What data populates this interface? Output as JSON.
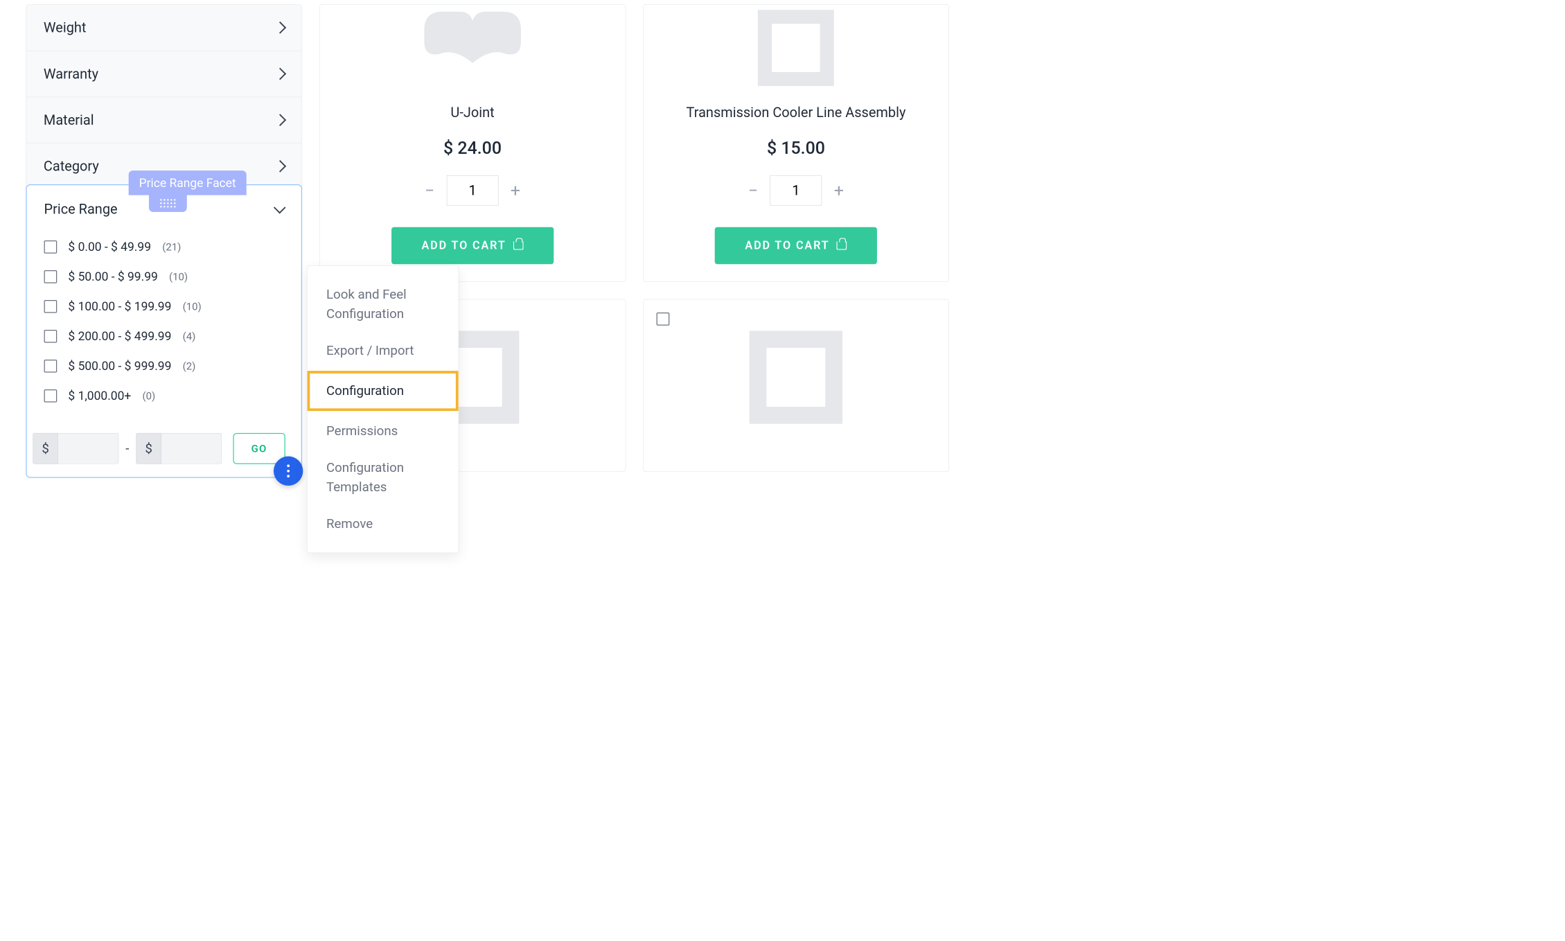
{
  "facets": {
    "weight": "Weight",
    "warranty": "Warranty",
    "material": "Material",
    "category": "Category",
    "price_range_label": "Price Range",
    "price_range_badge": "Price Range Facet"
  },
  "price_ranges": [
    {
      "label": "$ 0.00 - $ 49.99",
      "count": "(21)"
    },
    {
      "label": "$ 50.00 - $ 99.99",
      "count": "(10)"
    },
    {
      "label": "$ 100.00 - $ 199.99",
      "count": "(10)"
    },
    {
      "label": "$ 200.00 - $ 499.99",
      "count": "(4)"
    },
    {
      "label": "$ 500.00 - $ 999.99",
      "count": "(2)"
    },
    {
      "label": "$ 1,000.00+",
      "count": "(0)"
    }
  ],
  "price_input": {
    "currency": "$",
    "go": "GO"
  },
  "context_menu": {
    "look_feel": "Look and Feel Configuration",
    "export_import": "Export / Import",
    "configuration": "Configuration",
    "permissions": "Permissions",
    "templates": "Configuration Templates",
    "remove": "Remove"
  },
  "products": {
    "ujoint": {
      "title": "U-Joint",
      "price": "$ 24.00",
      "qty": "1",
      "cta": "ADD TO CART"
    },
    "transmission": {
      "title": "Transmission Cooler Line Assembly",
      "price": "$ 15.00",
      "qty": "1",
      "cta": "ADD TO CART"
    }
  }
}
